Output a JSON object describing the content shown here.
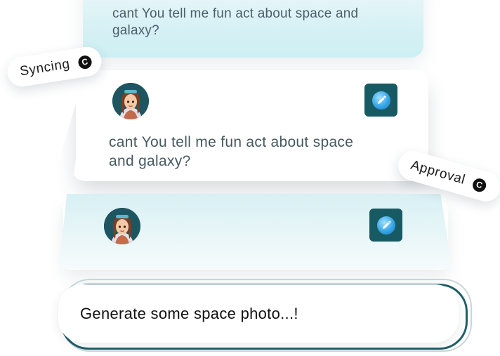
{
  "messages": {
    "top_text": "cant You tell me fun  act about space and galaxy?",
    "middle_text": "cant You tell me fun  act about space and galaxy?"
  },
  "tags": {
    "syncing": {
      "label": "Syncing",
      "icon": "copyright-icon",
      "glyph": "C"
    },
    "approval": {
      "label": "Approval",
      "icon": "copyright-icon",
      "glyph": "C"
    }
  },
  "prompt": {
    "placeholder": "Generate some space photo...!"
  },
  "icons": {
    "edit": "pencil-icon",
    "avatar": "girl-avatar"
  },
  "colors": {
    "accent_teal": "#185a63",
    "card_tint": "#d7f1f5",
    "text_muted": "#46595f"
  }
}
